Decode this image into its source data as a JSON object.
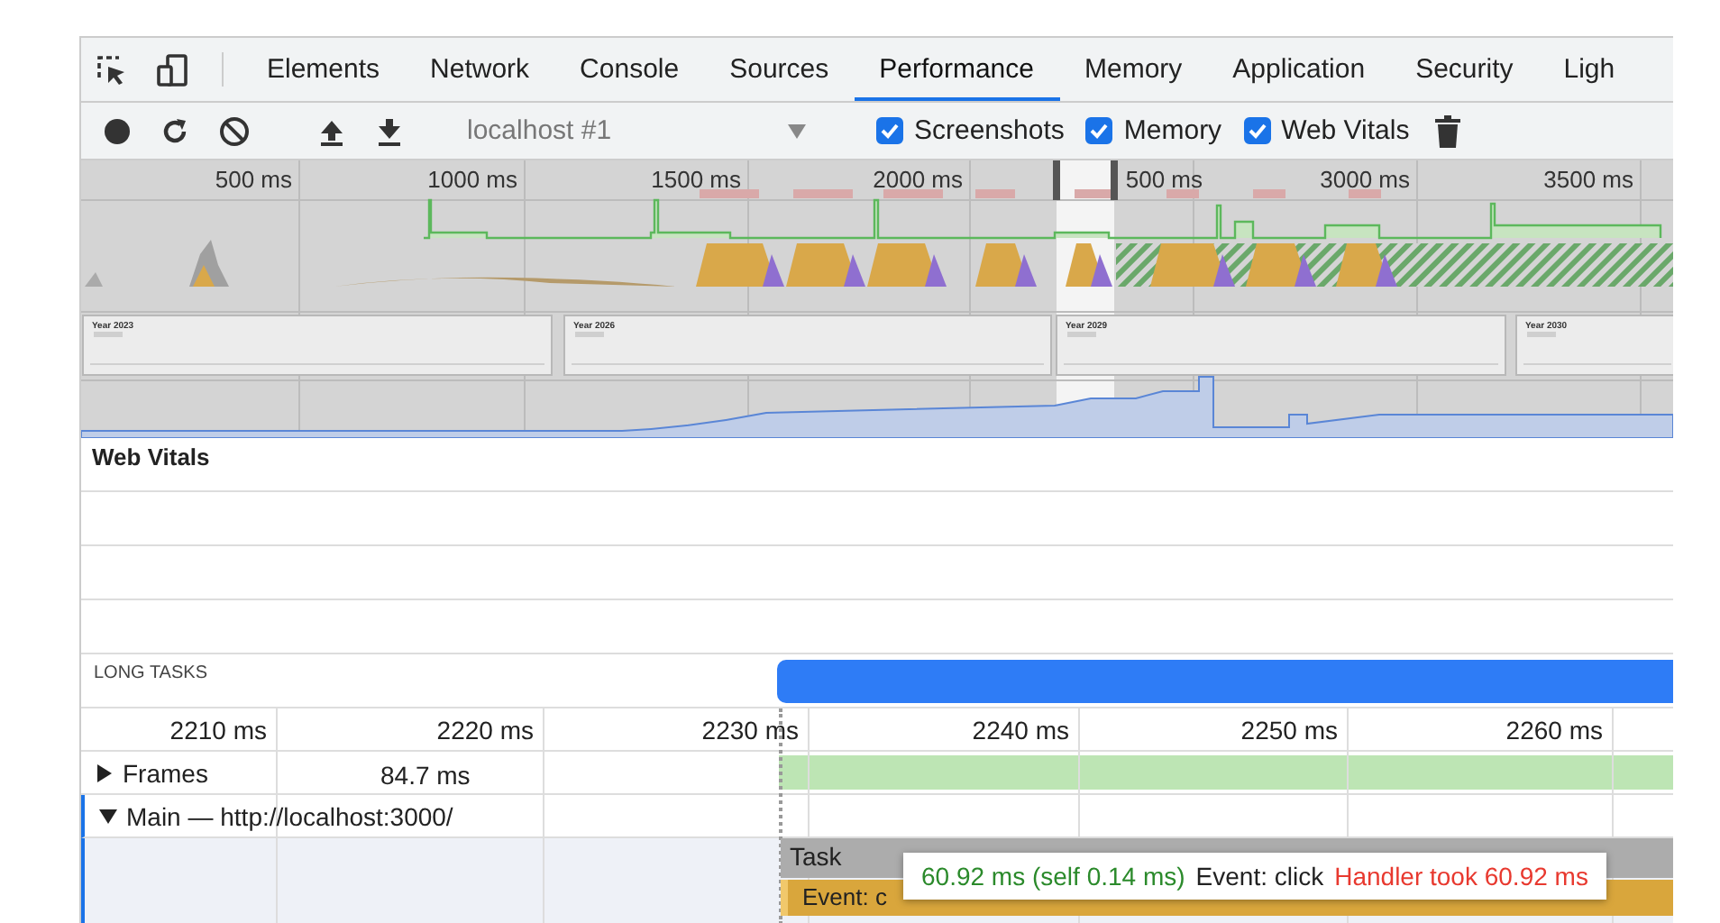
{
  "tabs": [
    {
      "label": "Elements",
      "selected": false
    },
    {
      "label": "Network",
      "selected": false
    },
    {
      "label": "Console",
      "selected": false
    },
    {
      "label": "Sources",
      "selected": false
    },
    {
      "label": "Performance",
      "selected": true
    },
    {
      "label": "Memory",
      "selected": false
    },
    {
      "label": "Application",
      "selected": false
    },
    {
      "label": "Security",
      "selected": false
    },
    {
      "label": "Ligh",
      "selected": false
    }
  ],
  "target_select": {
    "value": "localhost #1"
  },
  "checkboxes": [
    {
      "label": "Screenshots",
      "checked": true
    },
    {
      "label": "Memory",
      "checked": true
    },
    {
      "label": "Web Vitals",
      "checked": true
    }
  ],
  "overview": {
    "ticks": [
      "500 ms",
      "1000 ms",
      "1500 ms",
      "2000 ms",
      "500 ms",
      "3000 ms",
      "3500 ms"
    ],
    "screenshots": [
      {
        "title": "Year 2023"
      },
      {
        "title": "Year 2026"
      },
      {
        "title": "Year 2029"
      },
      {
        "title": "Year 2030"
      }
    ]
  },
  "web_vitals": {
    "title": "Web Vitals"
  },
  "long_tasks": {
    "title": "LONG TASKS"
  },
  "ruler": [
    "2210 ms",
    "2220 ms",
    "2230 ms",
    "2240 ms",
    "2250 ms",
    "2260 ms"
  ],
  "tracks": [
    {
      "label": "Frames",
      "expanded": false,
      "value": "84.7 ms"
    },
    {
      "label": "Main — http://localhost:3000/",
      "expanded": true
    }
  ],
  "flame": [
    {
      "label": "Task"
    },
    {
      "label": "Event: c"
    }
  ],
  "tooltip": {
    "duration": "60.92 ms (self 0.14 ms)",
    "event": "Event: click",
    "warning": "Handler took 60.92 ms"
  }
}
